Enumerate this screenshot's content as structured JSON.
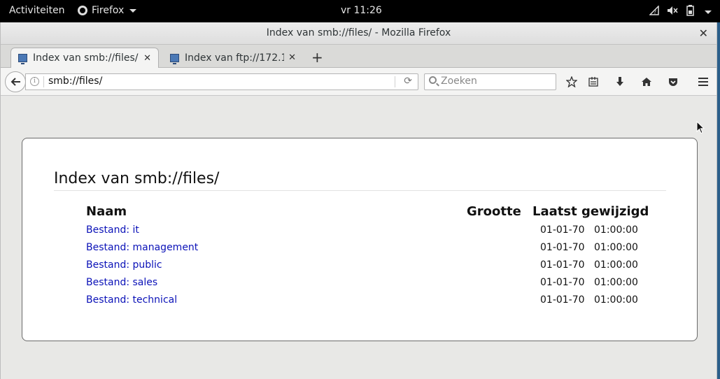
{
  "topbar": {
    "activities": "Activiteiten",
    "app_menu": "Firefox",
    "clock": "vr 11:26"
  },
  "window": {
    "title": "Index van smb://files/ - Mozilla Firefox"
  },
  "tabs": [
    {
      "label": "Index van smb://files/",
      "active": true
    },
    {
      "label": "Index van ftp://172.16...",
      "active": false
    }
  ],
  "navbar": {
    "url": "smb://files/",
    "search_placeholder": "Zoeken"
  },
  "page": {
    "heading": "Index van smb://files/",
    "columns": {
      "name": "Naam",
      "size": "Grootte",
      "modified": "Laatst gewijzigd"
    },
    "rows": [
      {
        "name": "Bestand: it",
        "date": "01-01-70",
        "time": "01:00:00"
      },
      {
        "name": "Bestand: management",
        "date": "01-01-70",
        "time": "01:00:00"
      },
      {
        "name": "Bestand: public",
        "date": "01-01-70",
        "time": "01:00:00"
      },
      {
        "name": "Bestand: sales",
        "date": "01-01-70",
        "time": "01:00:00"
      },
      {
        "name": "Bestand: technical",
        "date": "01-01-70",
        "time": "01:00:00"
      }
    ]
  },
  "icons": {
    "app_menu": "firefox-icon",
    "status": [
      "network-wireless-icon",
      "volume-muted-icon",
      "battery-icon",
      "system-menu-caret-icon"
    ],
    "toolbar": [
      "bookmark-star-icon",
      "bookmarks-list-icon",
      "downloads-icon",
      "home-icon",
      "pocket-icon",
      "hamburger-menu-icon"
    ]
  }
}
